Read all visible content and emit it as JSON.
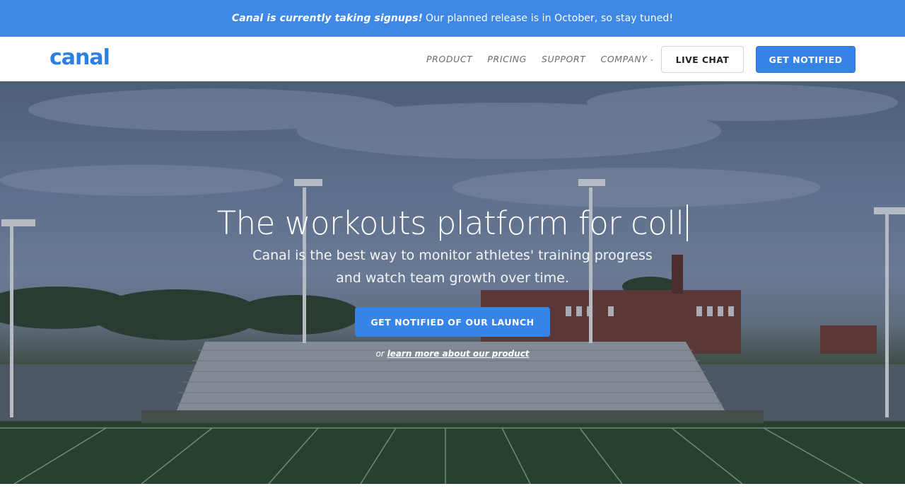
{
  "announcement": {
    "strong": "Canal is currently taking signups!",
    "text": "Our planned release is in October, so stay tuned!"
  },
  "header": {
    "logo": "canal",
    "nav": [
      {
        "label": "PRODUCT"
      },
      {
        "label": "PRICING"
      },
      {
        "label": "SUPPORT"
      },
      {
        "label": "COMPANY"
      }
    ],
    "live_chat": "LIVE CHAT",
    "get_notified": "GET NOTIFIED"
  },
  "hero": {
    "headline": "The workouts platform for coll",
    "subline_1": "Canal is the best way to monitor athletes' training progress",
    "subline_2": "and watch team growth over time.",
    "cta": "GET NOTIFIED OF OUR LAUNCH",
    "or_text": "or",
    "learn_link": "learn more about our product"
  },
  "colors": {
    "accent": "#3f88e6",
    "button": "#3583e4"
  }
}
